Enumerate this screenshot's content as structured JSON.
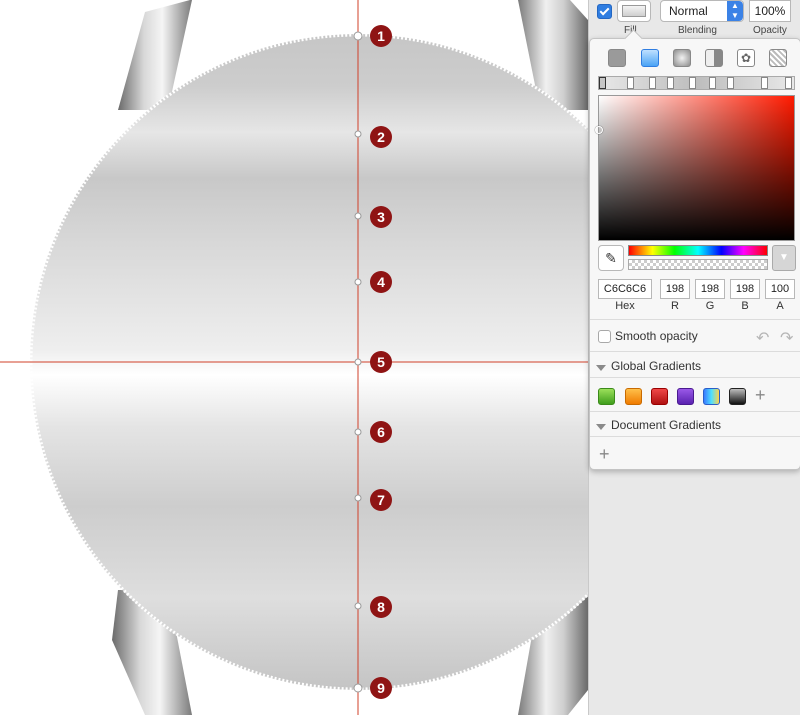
{
  "canvas": {
    "markers": [
      "1",
      "2",
      "3",
      "4",
      "5",
      "6",
      "7",
      "8",
      "9"
    ],
    "colors": {
      "guide": "#d0402a",
      "marker": "#8f1414"
    }
  },
  "inspector": {
    "fill_enabled": true,
    "blending": "Normal",
    "opacity_value": "100%",
    "labels": {
      "fill": "Fill",
      "blending": "Blending",
      "opacity": "Opacity"
    },
    "color": {
      "hex": "C6C6C6",
      "r": "198",
      "g": "198",
      "b": "198",
      "a": "100",
      "labels": {
        "hex": "Hex",
        "r": "R",
        "g": "G",
        "b": "B",
        "a": "A"
      }
    },
    "smooth_opacity": {
      "label": "Smooth opacity",
      "checked": false
    },
    "global_gradients": {
      "title": "Global Gradients",
      "swatches": [
        "green-gradient",
        "orange-gradient",
        "red-gradient",
        "purple-gradient",
        "blue-spectrum-gradient",
        "dark-gradient"
      ]
    },
    "document_gradients": {
      "title": "Document Gradients"
    }
  }
}
